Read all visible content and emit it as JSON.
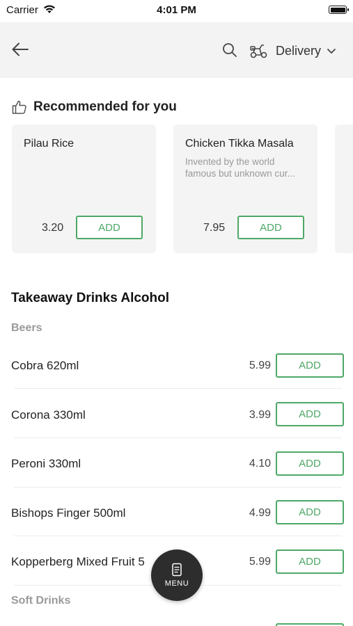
{
  "status_bar": {
    "carrier": "Carrier",
    "time": "4:01 PM"
  },
  "nav": {
    "delivery_label": "Delivery"
  },
  "recommended": {
    "title": "Recommended for you",
    "cards": [
      {
        "name": "Pilau Rice",
        "description": "",
        "price": "3.20",
        "add_label": "ADD"
      },
      {
        "name": "Chicken Tikka Masala",
        "description": "Invented by the world famous but unknown cur...",
        "price": "7.95",
        "add_label": "ADD"
      }
    ]
  },
  "category": {
    "title": "Takeaway Drinks Alcohol",
    "subsections": [
      "Beers",
      "Soft Drinks"
    ],
    "items": [
      {
        "name": "Cobra 620ml",
        "price": "5.99",
        "add_label": "ADD"
      },
      {
        "name": "Corona 330ml",
        "price": "3.99",
        "add_label": "ADD"
      },
      {
        "name": "Peroni 330ml",
        "price": "4.10",
        "add_label": "ADD"
      },
      {
        "name": "Bishops Finger 500ml",
        "price": "4.99",
        "add_label": "ADD"
      },
      {
        "name": "Kopperberg Mixed Fruit 5",
        "price": "5.99",
        "add_label": "ADD"
      }
    ]
  },
  "menu_button": {
    "label": "MENU"
  },
  "colors": {
    "accent": "#4da866",
    "nav_background": "#f3f3f3",
    "card_background": "#f4f4f4",
    "fab": "#2d2d2d"
  }
}
